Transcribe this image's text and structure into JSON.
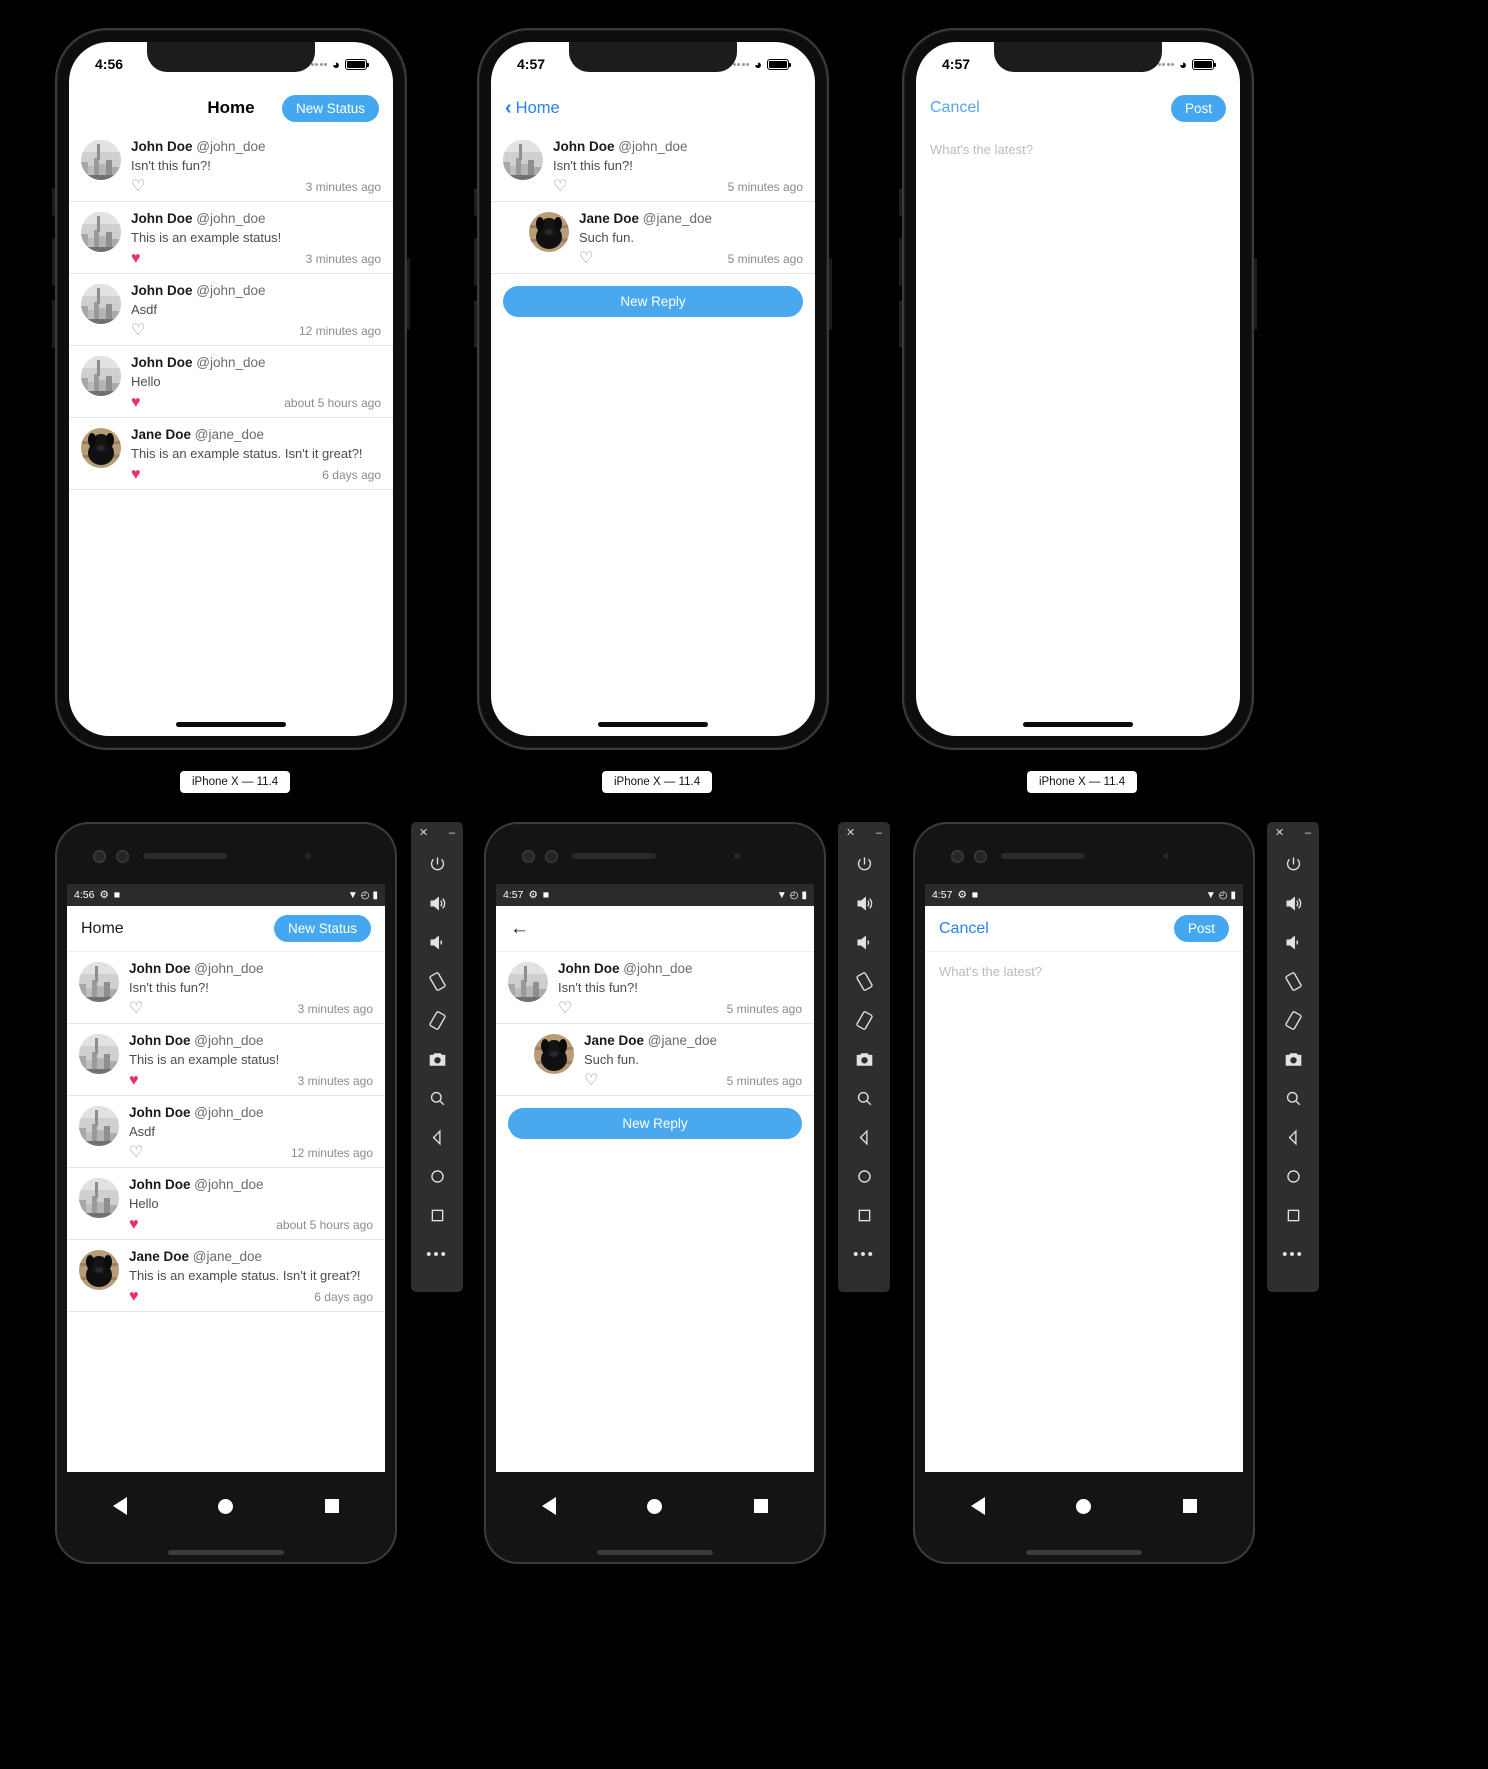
{
  "simulators": {
    "ios_label": "iPhone X — 11.4",
    "screens": [
      {
        "id": "ios-home",
        "status_time": "4:56",
        "nav": {
          "title": "Home",
          "action_label": "New Status"
        },
        "statuses": [
          {
            "name": "John Doe",
            "handle": "@john_doe",
            "text": "Isn't this fun?!",
            "liked": false,
            "ago": "3 minutes ago",
            "avatar": "city"
          },
          {
            "name": "John Doe",
            "handle": "@john_doe",
            "text": "This is an example status!",
            "liked": true,
            "ago": "3 minutes ago",
            "avatar": "city"
          },
          {
            "name": "John Doe",
            "handle": "@john_doe",
            "text": "Asdf",
            "liked": false,
            "ago": "12 minutes ago",
            "avatar": "city"
          },
          {
            "name": "John Doe",
            "handle": "@john_doe",
            "text": "Hello",
            "liked": true,
            "ago": "about 5 hours ago",
            "avatar": "city"
          },
          {
            "name": "Jane Doe",
            "handle": "@jane_doe",
            "text": "This is an example status. Isn't it great?!",
            "liked": true,
            "ago": "6 days ago",
            "avatar": "dog"
          }
        ]
      },
      {
        "id": "ios-thread",
        "status_time": "4:57",
        "nav": {
          "back_label": "Home"
        },
        "statuses": [
          {
            "name": "John Doe",
            "handle": "@john_doe",
            "text": "Isn't this fun?!",
            "liked": false,
            "ago": "5 minutes ago",
            "avatar": "city",
            "indent": false
          },
          {
            "name": "Jane Doe",
            "handle": "@jane_doe",
            "text": "Such fun.",
            "liked": false,
            "ago": "5 minutes ago",
            "avatar": "dog",
            "indent": true
          }
        ],
        "reply_button": "New Reply"
      },
      {
        "id": "ios-compose",
        "status_time": "4:57",
        "nav": {
          "cancel_label": "Cancel",
          "post_label": "Post"
        },
        "compose_placeholder": "What's the latest?"
      }
    ]
  },
  "android": {
    "screens": [
      {
        "id": "android-home",
        "status_time": "4:56",
        "nav": {
          "title": "Home",
          "action_label": "New Status"
        },
        "statuses": [
          {
            "name": "John Doe",
            "handle": "@john_doe",
            "text": "Isn't this fun?!",
            "liked": false,
            "ago": "3 minutes ago",
            "avatar": "city"
          },
          {
            "name": "John Doe",
            "handle": "@john_doe",
            "text": "This is an example status!",
            "liked": true,
            "ago": "3 minutes ago",
            "avatar": "city"
          },
          {
            "name": "John Doe",
            "handle": "@john_doe",
            "text": "Asdf",
            "liked": false,
            "ago": "12 minutes ago",
            "avatar": "city"
          },
          {
            "name": "John Doe",
            "handle": "@john_doe",
            "text": "Hello",
            "liked": true,
            "ago": "about 5 hours ago",
            "avatar": "city"
          },
          {
            "name": "Jane Doe",
            "handle": "@jane_doe",
            "text": "This is an example status. Isn't it great?!",
            "liked": true,
            "ago": "6 days ago",
            "avatar": "dog"
          }
        ]
      },
      {
        "id": "android-thread",
        "status_time": "4:57",
        "nav": {
          "back_icon": "arrow-left-icon"
        },
        "statuses": [
          {
            "name": "John Doe",
            "handle": "@john_doe",
            "text": "Isn't this fun?!",
            "liked": false,
            "ago": "5 minutes ago",
            "avatar": "city",
            "indent": false
          },
          {
            "name": "Jane Doe",
            "handle": "@jane_doe",
            "text": "Such fun.",
            "liked": false,
            "ago": "5 minutes ago",
            "avatar": "dog",
            "indent": true
          }
        ],
        "reply_button": "New Reply"
      },
      {
        "id": "android-compose",
        "status_time": "4:57",
        "nav": {
          "cancel_label": "Cancel",
          "post_label": "Post"
        },
        "compose_placeholder": "What's the latest?"
      }
    ],
    "emulator_toolbar": {
      "close_glyph": "✕",
      "minimize_glyph": "‒",
      "icons": [
        "power-icon",
        "volume-up-icon",
        "volume-down-icon",
        "rotate-left-icon",
        "rotate-right-icon",
        "camera-icon",
        "zoom-icon",
        "back-icon",
        "home-icon",
        "overview-icon",
        "more-icon"
      ]
    }
  },
  "colors": {
    "accent_blue": "#45a7ef",
    "link_blue": "#2b7ff0",
    "heart_on": "#e8315e",
    "heart_off": "#7f93aa",
    "android_statusbar": "#2b2b2b"
  }
}
